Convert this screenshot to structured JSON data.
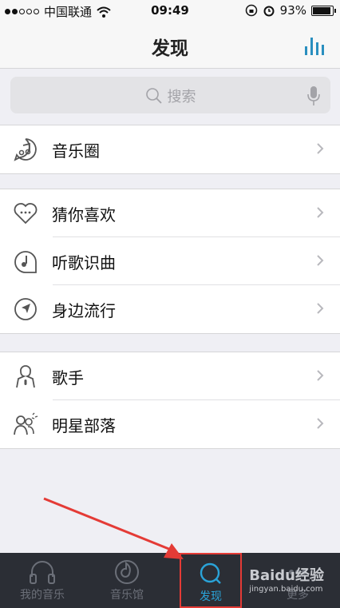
{
  "status": {
    "carrier": "中国联通",
    "time": "09:49",
    "battery": "93%",
    "battery_level": 0.93
  },
  "nav": {
    "title": "发现"
  },
  "search": {
    "placeholder": "搜索"
  },
  "groups": [
    {
      "items": [
        {
          "label": "音乐圈",
          "icon": "music-circle-icon"
        }
      ]
    },
    {
      "items": [
        {
          "label": "猜你喜欢",
          "icon": "heart-chat-icon"
        },
        {
          "label": "听歌识曲",
          "icon": "music-recognize-icon"
        },
        {
          "label": "身边流行",
          "icon": "location-arrow-icon"
        }
      ]
    },
    {
      "items": [
        {
          "label": "歌手",
          "icon": "singer-icon"
        },
        {
          "label": "明星部落",
          "icon": "star-tribe-icon"
        }
      ]
    }
  ],
  "tabs": [
    {
      "label": "我的音乐",
      "icon": "headphones-icon"
    },
    {
      "label": "音乐馆",
      "icon": "music-hall-icon"
    },
    {
      "label": "发现",
      "icon": "discover-icon",
      "active": true
    },
    {
      "label": "更多",
      "icon": "more-icon"
    }
  ],
  "watermark": {
    "brand": "Baidu经验",
    "url": "jingyan.baidu.com"
  },
  "colors": {
    "accent": "#2aa3d8",
    "annotation": "#e43b36",
    "tabbar_bg": "#2b2e35"
  }
}
